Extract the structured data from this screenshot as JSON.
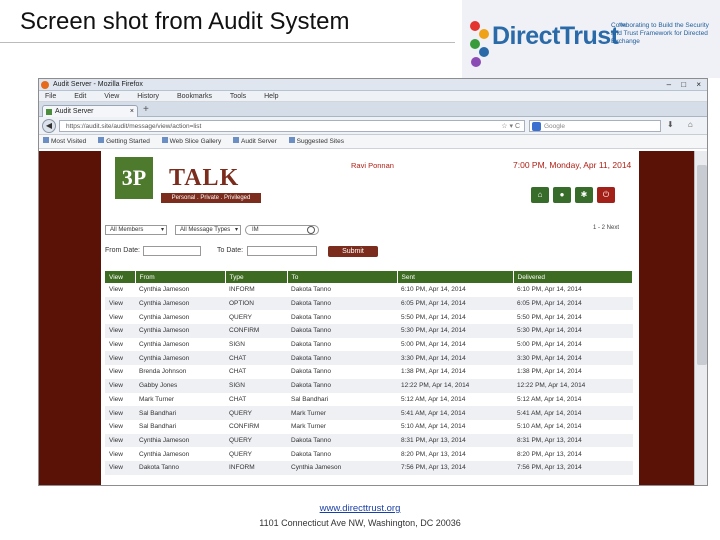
{
  "slide": {
    "title": "Screen shot from Audit System",
    "footer_link": "www.directtrust.org",
    "footer_address": "1101 Connecticut Ave NW, Washington, DC 20036"
  },
  "logo": {
    "name": "DirectTrust",
    "tm": "™",
    "tagline": "Collaborating to Build the Security and Trust Framework for Directed Exchange"
  },
  "browser": {
    "window_title": "Audit Server - Mozilla Firefox",
    "window_controls": "– □ ×",
    "menu": [
      "File",
      "Edit",
      "View",
      "History",
      "Bookmarks",
      "Tools",
      "Help"
    ],
    "tab_label": "Audit Server",
    "tab_close": "×",
    "new_tab": "+",
    "back": "◀",
    "url": "https://audit.site/audit/message/view/action=list",
    "url_icons": "☆ ▾ C",
    "search_placeholder": "Google",
    "nav_icons": "⬇ ⌂",
    "bookmarks": [
      "Most Visited",
      "Getting Started",
      "Web Slice Gallery",
      "Audit Server",
      "Suggested Sites"
    ]
  },
  "app": {
    "logo_mark": "3P",
    "logo_name": "TALK",
    "logo_tagline": "Personal . Private . Privileged",
    "user_name": "Ravi Ponnan",
    "datetime": "7:00 PM, Monday, Apr 11, 2014",
    "toolbar": {
      "home": "⌂",
      "user": "●",
      "settings": "✱",
      "power": "⏻"
    },
    "filters": {
      "members_select": "All Members",
      "types_select": "All Message Types",
      "search_value": "IM",
      "from_label": "From Date:",
      "to_label": "To Date:",
      "submit_label": "Submit",
      "pager": "1 - 2  Next"
    },
    "table": {
      "headers": [
        "View",
        "From",
        "Type",
        "To",
        "Sent",
        "Delivered"
      ],
      "rows": [
        [
          "View",
          "Cynthia Jameson",
          "INFORM",
          "Dakota Tanno",
          "6:10 PM, Apr 14, 2014",
          "6:10 PM, Apr 14, 2014"
        ],
        [
          "View",
          "Cynthia Jameson",
          "OPTION",
          "Dakota Tanno",
          "6:05 PM, Apr 14, 2014",
          "6:05 PM, Apr 14, 2014"
        ],
        [
          "View",
          "Cynthia Jameson",
          "QUERY",
          "Dakota Tanno",
          "5:50 PM, Apr 14, 2014",
          "5:50 PM, Apr 14, 2014"
        ],
        [
          "View",
          "Cynthia Jameson",
          "CONFIRM",
          "Dakota Tanno",
          "5:30 PM, Apr 14, 2014",
          "5:30 PM, Apr 14, 2014"
        ],
        [
          "View",
          "Cynthia Jameson",
          "SIGN",
          "Dakota Tanno",
          "5:00 PM, Apr 14, 2014",
          "5:00 PM, Apr 14, 2014"
        ],
        [
          "View",
          "Cynthia Jameson",
          "CHAT",
          "Dakota Tanno",
          "3:30 PM, Apr 14, 2014",
          "3:30 PM, Apr 14, 2014"
        ],
        [
          "View",
          "Brenda Johnson",
          "CHAT",
          "Dakota Tanno",
          "1:38 PM, Apr 14, 2014",
          "1:38 PM, Apr 14, 2014"
        ],
        [
          "View",
          "Gabby Jones",
          "SIGN",
          "Dakota Tanno",
          "12:22 PM, Apr 14, 2014",
          "12:22 PM, Apr 14, 2014"
        ],
        [
          "View",
          "Mark Turner",
          "CHAT",
          "Sal Bandhari",
          "5:12 AM, Apr 14, 2014",
          "5:12 AM, Apr 14, 2014"
        ],
        [
          "View",
          "Sal Bandhari",
          "QUERY",
          "Mark Turner",
          "5:41 AM, Apr 14, 2014",
          "5:41 AM, Apr 14, 2014"
        ],
        [
          "View",
          "Sal Bandhari",
          "CONFIRM",
          "Mark Turner",
          "5:10 AM, Apr 14, 2014",
          "5:10 AM, Apr 14, 2014"
        ],
        [
          "View",
          "Cynthia Jameson",
          "QUERY",
          "Dakota Tanno",
          "8:31 PM, Apr 13, 2014",
          "8:31 PM, Apr 13, 2014"
        ],
        [
          "View",
          "Cynthia Jameson",
          "QUERY",
          "Dakota Tanno",
          "8:20 PM, Apr 13, 2014",
          "8:20 PM, Apr 13, 2014"
        ],
        [
          "View",
          "Dakota Tanno",
          "INFORM",
          "Cynthia Jameson",
          "7:56 PM, Apr 13, 2014",
          "7:56 PM, Apr 13, 2014"
        ]
      ]
    }
  },
  "colors": {
    "header_green": "#3e6b22",
    "brand_maroon": "#7b2c1c",
    "background_maroon": "#5b1206",
    "accent_red": "#b01e14",
    "link_blue": "#1a3fa8"
  }
}
